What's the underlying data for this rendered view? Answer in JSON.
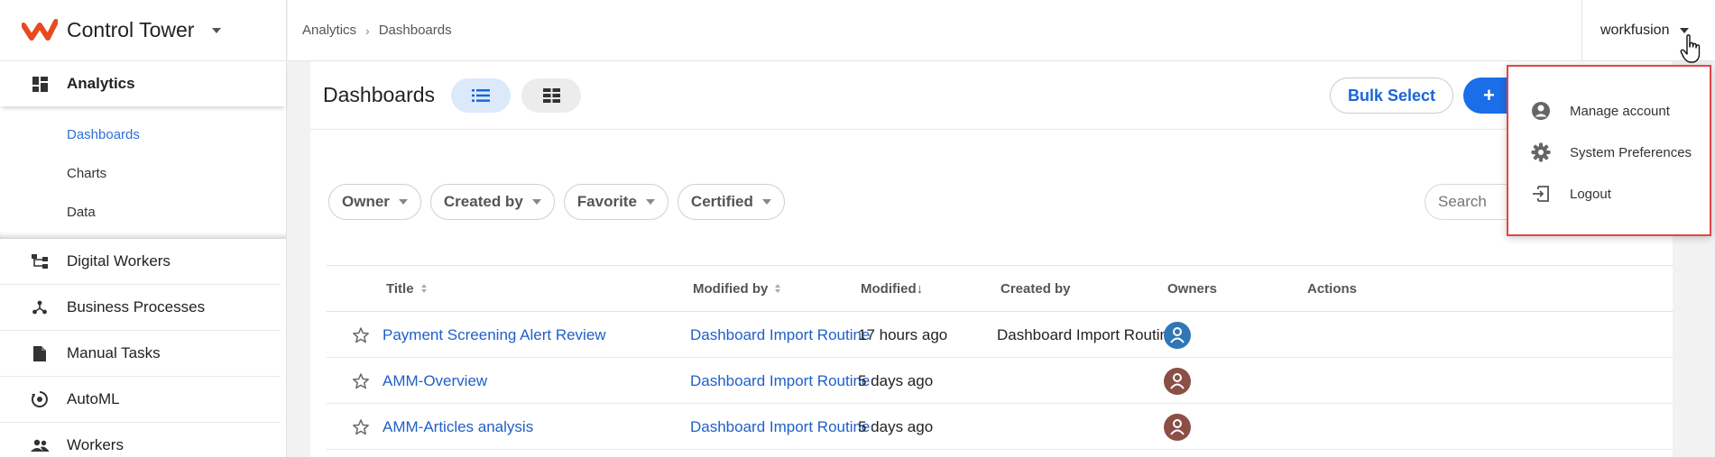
{
  "brand": {
    "name": "Control Tower"
  },
  "breadcrumb": {
    "root": "Analytics",
    "separator": "›",
    "current": "Dashboards"
  },
  "user_menu": {
    "name": "workfusion"
  },
  "sidebar": {
    "section": {
      "label": "Analytics",
      "sub_items": [
        "Dashboards",
        "Charts",
        "Data"
      ],
      "active": "Dashboards"
    },
    "items": [
      {
        "label": "Digital Workers",
        "icon": "digital-workers-icon"
      },
      {
        "label": "Business Processes",
        "icon": "business-processes-icon"
      },
      {
        "label": "Manual Tasks",
        "icon": "manual-tasks-icon"
      },
      {
        "label": "AutoML",
        "icon": "automl-icon"
      },
      {
        "label": "Workers",
        "icon": "workers-icon"
      }
    ]
  },
  "main": {
    "title": "Dashboards",
    "bulk_select_label": "Bulk Select",
    "new_button_label": "+",
    "filters": [
      "Owner",
      "Created by",
      "Favorite",
      "Certified"
    ],
    "search_placeholder": "Search",
    "table": {
      "columns": {
        "title": "Title",
        "modified_by": "Modified by",
        "modified": "Modified↓",
        "created_by": "Created by",
        "owners": "Owners",
        "actions": "Actions"
      },
      "rows": [
        {
          "title": "Payment Screening Alert Review",
          "modified_by": "Dashboard Import Routine",
          "modified": "17 hours ago",
          "created_by": "Dashboard Import Routine",
          "owner_color": "#2f77b5"
        },
        {
          "title": "AMM-Overview",
          "modified_by": "Dashboard Import Routine",
          "modified": "5 days ago",
          "created_by": "",
          "owner_color": "#8a4f45"
        },
        {
          "title": "AMM-Articles analysis",
          "modified_by": "Dashboard Import Routine",
          "modified": "5 days ago",
          "created_by": "",
          "owner_color": "#8a4f45"
        }
      ]
    }
  },
  "dropdown": {
    "items": [
      {
        "label": "Manage account",
        "icon": "account-circle-icon"
      },
      {
        "label": "System Preferences",
        "icon": "gear-icon"
      },
      {
        "label": "Logout",
        "icon": "logout-icon"
      }
    ],
    "highlight_color": "#e04646"
  },
  "colors": {
    "accent": "#1a6ee8",
    "link": "#1f5fc9",
    "brand": "#e8491d"
  }
}
